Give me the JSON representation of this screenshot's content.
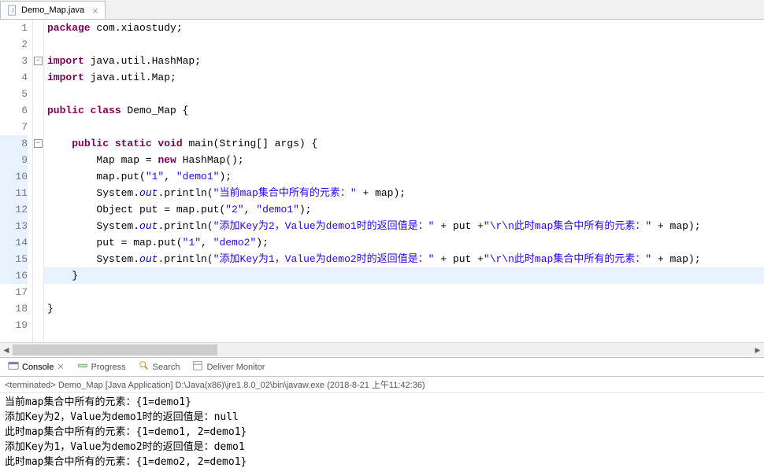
{
  "tab": {
    "filename": "Demo_Map.java",
    "close": "×"
  },
  "code": {
    "lines": [
      {
        "n": 1,
        "tokens": [
          {
            "t": "package",
            "c": "kw"
          },
          {
            "t": " com.xiaostudy;",
            "c": "plain"
          }
        ]
      },
      {
        "n": 2,
        "tokens": []
      },
      {
        "n": 3,
        "fold": true,
        "tokens": [
          {
            "t": "import",
            "c": "kw"
          },
          {
            "t": " java.util.HashMap;",
            "c": "plain"
          }
        ]
      },
      {
        "n": 4,
        "tokens": [
          {
            "t": "import",
            "c": "kw"
          },
          {
            "t": " java.util.Map;",
            "c": "plain"
          }
        ]
      },
      {
        "n": 5,
        "tokens": []
      },
      {
        "n": 6,
        "tokens": [
          {
            "t": "public class",
            "c": "kw"
          },
          {
            "t": " Demo_Map {",
            "c": "plain"
          }
        ]
      },
      {
        "n": 7,
        "tokens": []
      },
      {
        "n": 8,
        "fold": true,
        "tokens": [
          {
            "t": "    ",
            "c": "plain"
          },
          {
            "t": "public static void",
            "c": "kw"
          },
          {
            "t": " main(String[] args) {",
            "c": "plain"
          }
        ]
      },
      {
        "n": 9,
        "tokens": [
          {
            "t": "        Map map = ",
            "c": "plain"
          },
          {
            "t": "new",
            "c": "kw"
          },
          {
            "t": " HashMap();",
            "c": "plain"
          }
        ]
      },
      {
        "n": 10,
        "tokens": [
          {
            "t": "        map.put(",
            "c": "plain"
          },
          {
            "t": "\"1\"",
            "c": "str"
          },
          {
            "t": ", ",
            "c": "plain"
          },
          {
            "t": "\"demo1\"",
            "c": "str"
          },
          {
            "t": ");",
            "c": "plain"
          }
        ]
      },
      {
        "n": 11,
        "tokens": [
          {
            "t": "        System.",
            "c": "plain"
          },
          {
            "t": "out",
            "c": "fld"
          },
          {
            "t": ".println(",
            "c": "plain"
          },
          {
            "t": "\"当前map集合中所有的元素：\"",
            "c": "str"
          },
          {
            "t": " + map);",
            "c": "plain"
          }
        ]
      },
      {
        "n": 12,
        "tokens": [
          {
            "t": "        Object put = map.put(",
            "c": "plain"
          },
          {
            "t": "\"2\"",
            "c": "str"
          },
          {
            "t": ", ",
            "c": "plain"
          },
          {
            "t": "\"demo1\"",
            "c": "str"
          },
          {
            "t": ");",
            "c": "plain"
          }
        ]
      },
      {
        "n": 13,
        "tokens": [
          {
            "t": "        System.",
            "c": "plain"
          },
          {
            "t": "out",
            "c": "fld"
          },
          {
            "t": ".println(",
            "c": "plain"
          },
          {
            "t": "\"添加Key为2，Value为demo1时的返回值是：\"",
            "c": "str"
          },
          {
            "t": " + put +",
            "c": "plain"
          },
          {
            "t": "\"\\r\\n此时map集合中所有的元素：\"",
            "c": "str"
          },
          {
            "t": " + map);",
            "c": "plain"
          }
        ]
      },
      {
        "n": 14,
        "tokens": [
          {
            "t": "        put = map.put(",
            "c": "plain"
          },
          {
            "t": "\"1\"",
            "c": "str"
          },
          {
            "t": ", ",
            "c": "plain"
          },
          {
            "t": "\"demo2\"",
            "c": "str"
          },
          {
            "t": ");",
            "c": "plain"
          }
        ]
      },
      {
        "n": 15,
        "tokens": [
          {
            "t": "        System.",
            "c": "plain"
          },
          {
            "t": "out",
            "c": "fld"
          },
          {
            "t": ".println(",
            "c": "plain"
          },
          {
            "t": "\"添加Key为1，Value为demo2时的返回值是：\"",
            "c": "str"
          },
          {
            "t": " + put +",
            "c": "plain"
          },
          {
            "t": "\"\\r\\n此时map集合中所有的元素：\"",
            "c": "str"
          },
          {
            "t": " + map);",
            "c": "plain"
          }
        ]
      },
      {
        "n": 16,
        "hl": true,
        "tokens": [
          {
            "t": "    }",
            "c": "plain"
          }
        ]
      },
      {
        "n": 17,
        "tokens": []
      },
      {
        "n": 18,
        "tokens": [
          {
            "t": "}",
            "c": "plain"
          }
        ]
      },
      {
        "n": 19,
        "tokens": []
      }
    ],
    "highlight_rows_blue_gutter": [
      8,
      9,
      10,
      11,
      12,
      13,
      14,
      15,
      16
    ]
  },
  "console": {
    "tabs": [
      {
        "label": "Console",
        "active": true
      },
      {
        "label": "Progress",
        "active": false
      },
      {
        "label": "Search",
        "active": false
      },
      {
        "label": "Deliver Monitor",
        "active": false
      }
    ],
    "header": "<terminated> Demo_Map [Java Application] D:\\Java(x86)\\jre1.8.0_02\\bin\\javaw.exe (2018-8-21 上午11:42:36)",
    "output": [
      "当前map集合中所有的元素：{1=demo1}",
      "添加Key为2，Value为demo1时的返回值是：null",
      "此时map集合中所有的元素：{1=demo1, 2=demo1}",
      "添加Key为1，Value为demo2时的返回值是：demo1",
      "此时map集合中所有的元素：{1=demo2, 2=demo1}"
    ]
  }
}
